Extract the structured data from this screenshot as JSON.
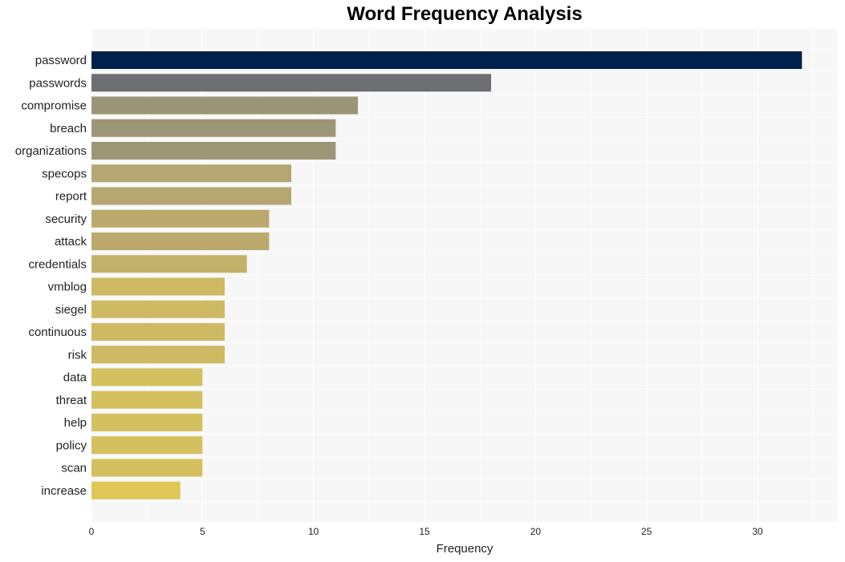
{
  "chart_data": {
    "type": "bar",
    "orientation": "horizontal",
    "title": "Word Frequency Analysis",
    "xlabel": "Frequency",
    "ylabel": "",
    "xlim": [
      0,
      33.6
    ],
    "xticks": [
      0,
      5,
      10,
      15,
      20,
      25,
      30
    ],
    "grid": true,
    "legend": "none",
    "categories": [
      "password",
      "passwords",
      "compromise",
      "breach",
      "organizations",
      "specops",
      "report",
      "security",
      "attack",
      "credentials",
      "vmblog",
      "siegel",
      "continuous",
      "risk",
      "data",
      "threat",
      "help",
      "policy",
      "scan",
      "increase"
    ],
    "values": [
      32,
      18,
      12,
      11,
      11,
      9,
      9,
      8,
      8,
      7,
      6,
      6,
      6,
      6,
      5,
      5,
      5,
      5,
      5,
      4
    ],
    "colors": [
      "#00214d",
      "#6e6f74",
      "#9b9577",
      "#9d9676",
      "#9d9676",
      "#b4a772",
      "#b4a772",
      "#bba96d",
      "#bba96d",
      "#c4b169",
      "#ceba63",
      "#ceba63",
      "#ceba63",
      "#ceba63",
      "#d4c05f",
      "#d4c05f",
      "#d4c05f",
      "#d4c05f",
      "#d4c05f",
      "#dfc656"
    ]
  }
}
